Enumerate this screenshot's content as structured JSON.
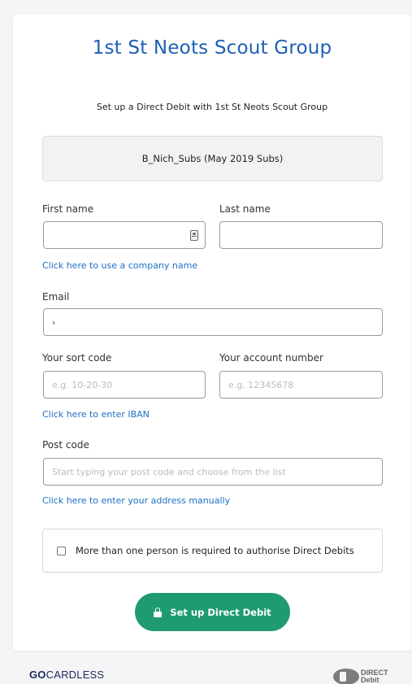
{
  "header": {
    "org_title": "1st St Neots Scout Group",
    "subtitle": "Set up a Direct Debit with 1st St Neots Scout Group"
  },
  "plan": {
    "description": "B_Nich_Subs (May 2019 Subs)"
  },
  "form": {
    "first_name_label": "First name",
    "first_name_value": "",
    "last_name_label": "Last name",
    "last_name_value": "",
    "company_link": "Click here to use a company name",
    "email_label": "Email",
    "email_value": "›",
    "sort_code_label": "Your sort code",
    "sort_code_placeholder": "e.g. 10-20-30",
    "account_number_label": "Your account number",
    "account_number_placeholder": "e.g. 12345678",
    "iban_link": "Click here to enter IBAN",
    "postcode_label": "Post code",
    "postcode_placeholder": "Start typing your post code and choose from the list",
    "address_link": "Click here to enter your address manually",
    "multi_auth_label": "More than one person is required to authorise Direct Debits",
    "multi_auth_checked": false,
    "submit_label": "Set up Direct Debit"
  },
  "footer": {
    "provider_bold": "GO",
    "provider_rest": "CARDLESS",
    "dd_line1": "DIRECT",
    "dd_line2": "Debit"
  },
  "colors": {
    "title_blue": "#1d5fb6",
    "link_blue": "#1d6fc4",
    "button_green": "#1f9b74",
    "background": "#f5f5f7"
  },
  "icons": {
    "first_name_field": "contact-card-icon",
    "submit_button": "lock-icon",
    "footer_dd": "direct-debit-logo"
  }
}
